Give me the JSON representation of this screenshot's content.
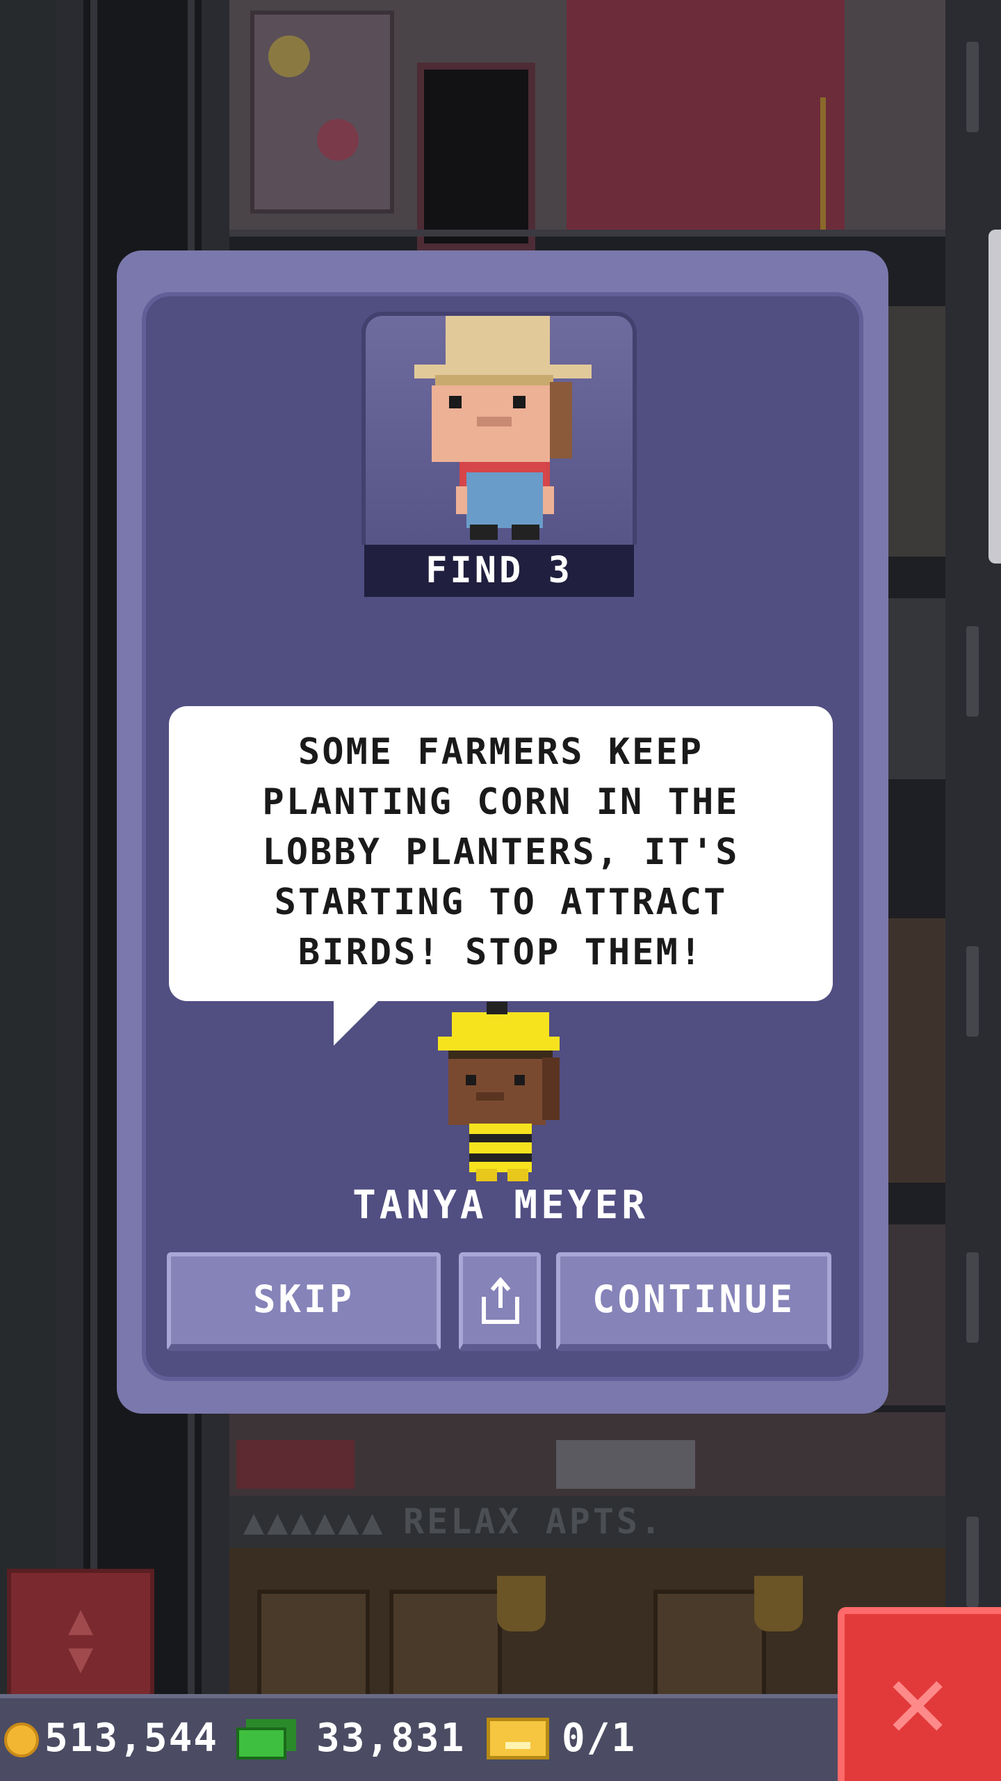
{
  "hud": {
    "coins": "513,544",
    "cash": "33,831",
    "tickets": "0/1"
  },
  "background": {
    "floor_sign": "RELAX APTS.",
    "floor_sign_stars": "▲▲▲▲▲▲"
  },
  "mission": {
    "portrait_label": "FIND 3",
    "message": "SOME FARMERS KEEP PLANTING CORN IN THE LOBBY PLANTERS, IT'S STARTING TO ATTRACT BIRDS! STOP THEM!",
    "npc_name": "TANYA MEYER"
  },
  "buttons": {
    "skip": "SKIP",
    "continue": "CONTINUE",
    "share_icon": "share-icon"
  },
  "colors": {
    "dialog_outer": "#7a78ac",
    "dialog_inner": "#514e82",
    "button": "#8583b8",
    "close_red": "#e23a3a"
  }
}
